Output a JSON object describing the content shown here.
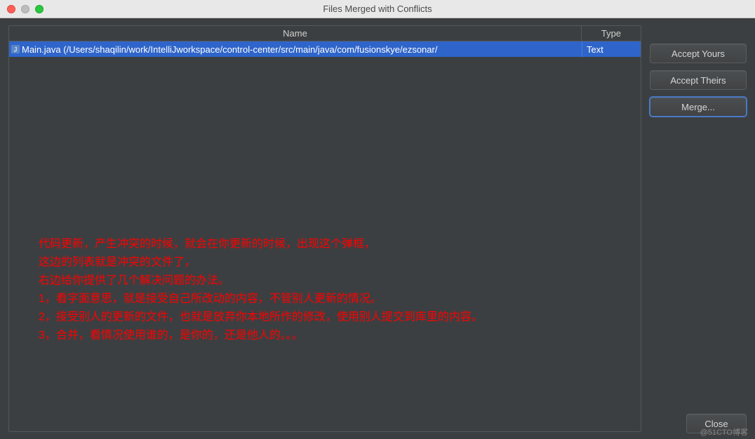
{
  "titlebar": {
    "title": "Files Merged with Conflicts"
  },
  "table": {
    "headers": {
      "name": "Name",
      "type": "Type"
    },
    "rows": [
      {
        "name": "Main.java (/Users/shaqilin/work/IntelliJworkspace/control-center/src/main/java/com/fusionskye/ezsonar/",
        "type": "Text"
      }
    ]
  },
  "buttons": {
    "accept_yours": "Accept Yours",
    "accept_theirs": "Accept Theirs",
    "merge": "Merge...",
    "close": "Close"
  },
  "annotation": {
    "l1": "代码更新，产生冲突的时候，就会在你更新的时候，出现这个弹框，",
    "l2": "这边的列表就是冲突的文件了，",
    "l3": "右边给你提供了几个解决问题的办法。",
    "l4": "1，看字面意思，就是接受自己所改动的内容，不管别人更新的情况。",
    "l5": "2，接受别人的更新的文件，也就是放弃你本地所作的修改，使用别人提交到库里的内容。",
    "l6": "3，合并，看情况使用谁的，是你的，还是他人的。。。"
  },
  "watermark": "@51CTO博客"
}
